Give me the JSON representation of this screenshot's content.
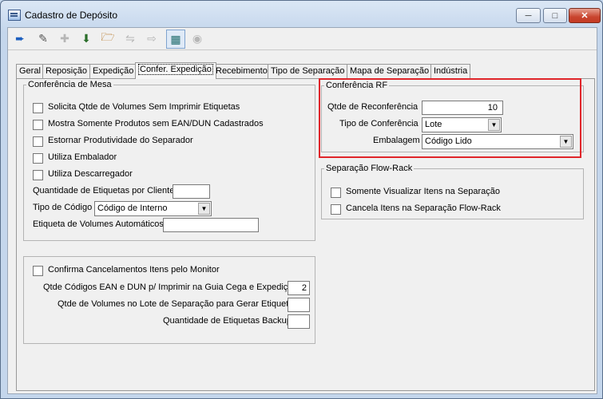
{
  "window": {
    "title": "Cadastro de Depósito"
  },
  "toolbar": {
    "icons": [
      "exit-icon",
      "edit-icon",
      "add-icon",
      "save-icon",
      "open-folder-icon",
      "export-icon",
      "import-icon",
      "grid-icon",
      "binoculars-icon"
    ]
  },
  "tabs": [
    "Geral",
    "Reposição",
    "Expedição",
    "Confer. Expedição",
    "Recebimento",
    "Tipo de Separação",
    "Mapa de Separação",
    "Indústria"
  ],
  "conferencia_mesa": {
    "legend": "Conferência de Mesa",
    "checkboxes": [
      "Solicita Qtde de Volumes Sem Imprimir Etiquetas",
      "Mostra Somente Produtos sem EAN/DUN Cadastrados",
      "Estornar Produtividade do Separador",
      "Utiliza Embalador",
      "Utiliza Descarregador"
    ],
    "qtd_etiquetas_label": "Quantidade de Etiquetas por Cliente",
    "qtd_etiquetas_value": "",
    "tipo_codigo_label": "Tipo de Código",
    "tipo_codigo_value": "Código de Interno",
    "etiqueta_volumes_label": "Etiqueta de Volumes Automáticos",
    "etiqueta_volumes_value": ""
  },
  "monitor_group": {
    "checkbox": "Confirma Cancelamentos Itens pelo Monitor",
    "qtde_codigos_label": "Qtde Códigos EAN e DUN p/ Imprimir na Guia Cega e Expedição",
    "qtde_codigos_value": "2",
    "qtde_volumes_label": "Qtde de Volumes no Lote de Separação para Gerar Etiquetas",
    "qtde_volumes_value": "",
    "qtd_backup_label": "Quantidade de Etiquetas Backup",
    "qtd_backup_value": ""
  },
  "conferencia_rf": {
    "legend": "Conferência RF",
    "qtde_reconf_label": "Qtde de Reconferência",
    "qtde_reconf_value": "10",
    "tipo_conf_label": "Tipo de Conferência",
    "tipo_conf_value": "Lote",
    "embalagem_label": "Embalagem",
    "embalagem_value": "Código Lido"
  },
  "flow_rack": {
    "legend": "Separação Flow-Rack",
    "checkboxes": [
      "Somente Visualizar Itens na Separação",
      "Cancela Itens na Separação Flow-Rack"
    ]
  },
  "colors": {
    "highlight": "#e0252a",
    "close_button": "#c9452f"
  }
}
